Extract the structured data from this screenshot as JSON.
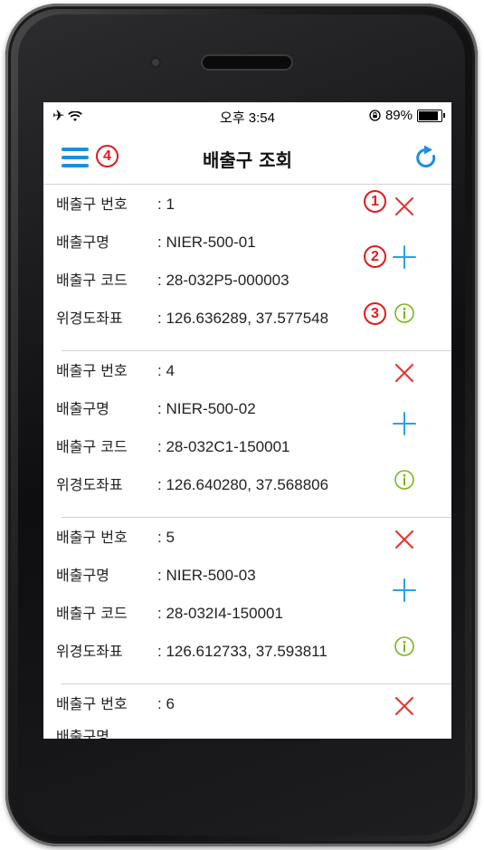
{
  "status_bar": {
    "time": "오후 3:54",
    "battery": "89%",
    "battery_level": 0.89,
    "left_icons": "airplane-icon, wifi-icon",
    "lock_icon": "rotation-lock-icon"
  },
  "header": {
    "title": "배출구 조회",
    "menu_icon": "hamburger-menu-icon",
    "refresh_icon": "refresh-icon",
    "menu_annotation": "4"
  },
  "labels": {
    "number": "배출구 번호",
    "name": "배출구명",
    "code": "배출구 코드",
    "coords": "위경도좌표"
  },
  "items": [
    {
      "number": ": 1",
      "name": ": NIER-500-01",
      "code": ": 28-032P5-000003",
      "coords": ": 126.636289, 37.577548"
    },
    {
      "number": ": 4",
      "name": ": NIER-500-02",
      "code": ": 28-032C1-150001",
      "coords": ": 126.640280, 37.568806"
    },
    {
      "number": ": 5",
      "name": ": NIER-500-03",
      "code": ": 28-032I4-150001",
      "coords": ": 126.612733, 37.593811"
    },
    {
      "number": ": 6",
      "name": "",
      "code": "",
      "coords": ""
    }
  ],
  "annotations": {
    "delete": "1",
    "add": "2",
    "info": "3"
  },
  "colors": {
    "accent_blue": "#1a8fe0",
    "delete_red": "#e53935",
    "add_blue": "#29a3dd",
    "info_green": "#7cb518",
    "annotation_red": "#e01b1b"
  }
}
